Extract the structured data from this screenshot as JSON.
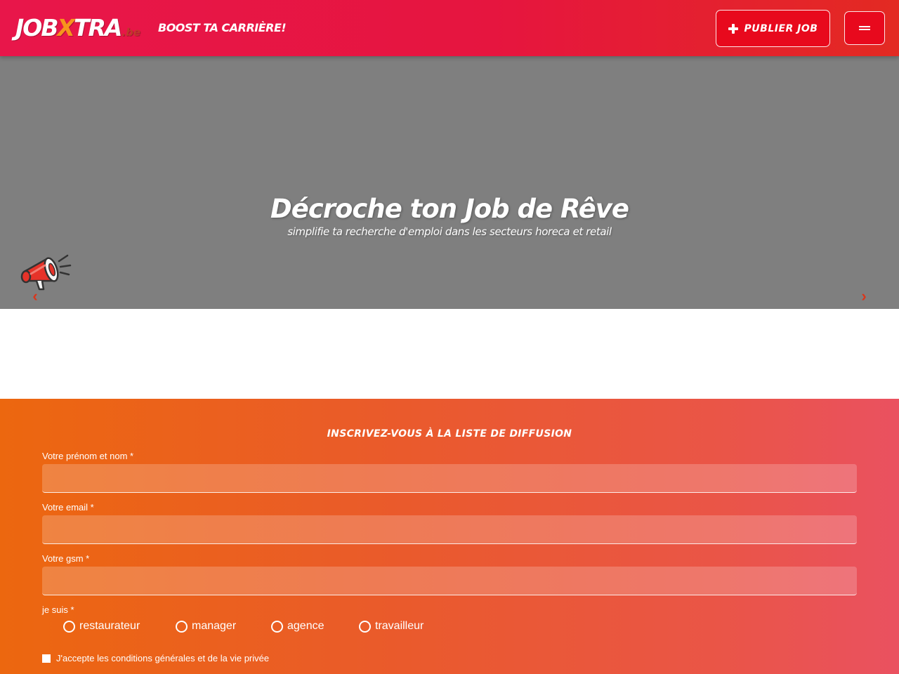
{
  "header": {
    "logo": {
      "main": "JOB",
      "x": "X",
      "rest": "TRA",
      "tld": ".be"
    },
    "tagline": "BOOST TA CARRIÈRE!",
    "publish_label": "PUBLIER JOB"
  },
  "hero": {
    "title": "Décroche ton Job de Rêve",
    "subtitle": "simplifie ta recherche d'emploi dans les secteurs horeca et retail",
    "prev_label": "‹",
    "next_label": "›"
  },
  "newsletter": {
    "title": "INSCRIVEZ-VOUS À LA LISTE DE DIFFUSION",
    "fields": [
      {
        "label": "Votre prénom et nom *",
        "value": ""
      },
      {
        "label": "Votre email *",
        "value": ""
      },
      {
        "label": "Votre gsm *",
        "value": ""
      }
    ],
    "role_label": "je suis *",
    "roles": [
      "restaurateur",
      "manager",
      "agence",
      "travailleur"
    ],
    "terms_label": "J'accepte les conditions générales et de la vie privée"
  },
  "colors": {
    "header": "#e6153f",
    "hero_bg": "#7f7f7f",
    "newsletter_start": "#ec670f",
    "newsletter_end": "#ea5160"
  }
}
